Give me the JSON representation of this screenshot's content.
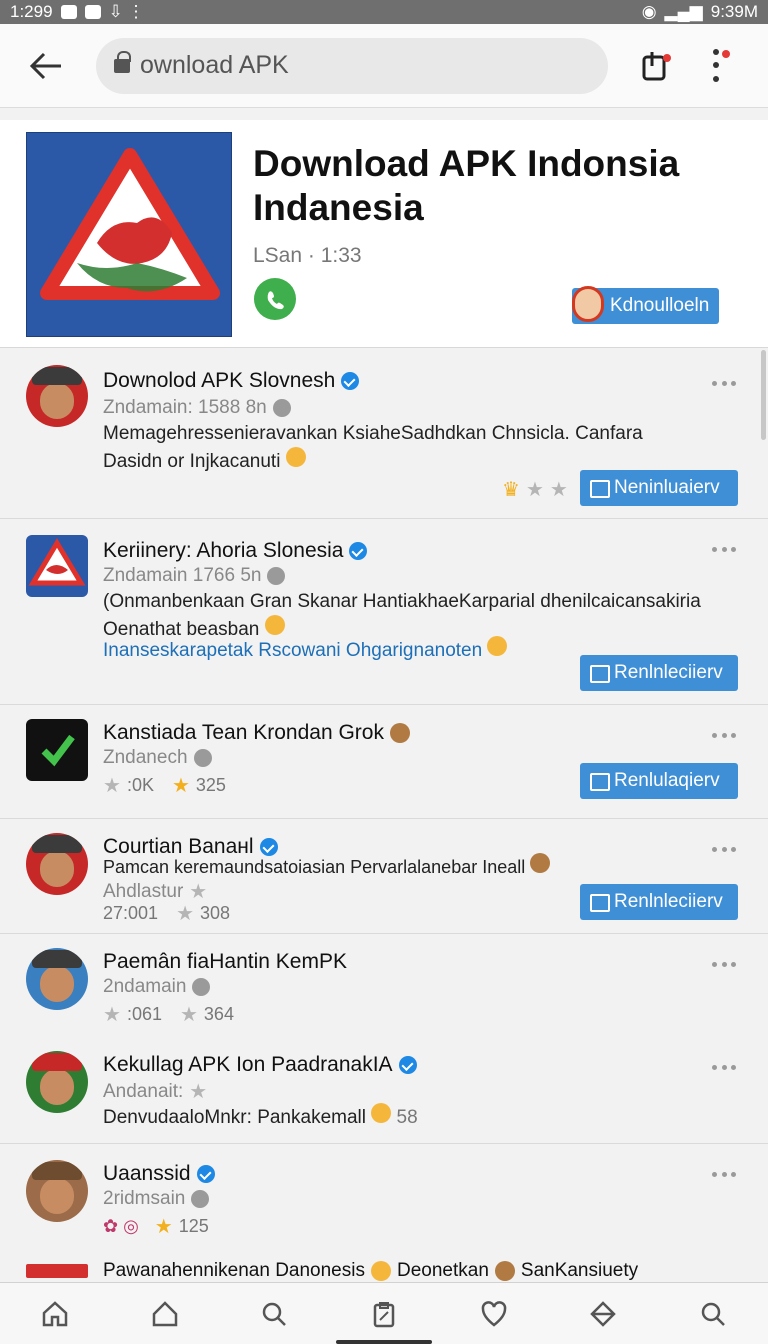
{
  "status_bar": {
    "time": "1:299",
    "clock_right": "9:39M"
  },
  "top_bar": {
    "url_text": "ownload APK"
  },
  "app_header": {
    "title": "Download APK Indonsia Indanesia",
    "meta": "LSan · 1:33",
    "download_label": "Kdnoulloeln"
  },
  "items": [
    {
      "name": "Downolod APK Slovnesh",
      "sub": "Zndamain: 1588 8n",
      "desc": "Memagehressenieravankan KsiaheSadhdkan Chnsicla. Canfara Dasidn or Injkacanuti",
      "action": "Neninluaierv"
    },
    {
      "name": "Keriinery: Ahoria Slonesia",
      "sub": "Zndamain 1766 5n",
      "desc": "(Onmanbenkaan Gran Skanar HantiakhaeKarparial dhenilcaicansakiria Oenathat beasban",
      "link": "Inanseskarapetak  Rscowani Ohgarignanoten",
      "action": "Renlnleciierv"
    },
    {
      "name": "Kanstiada Tean Krondan Grok",
      "sub": "Zndanech",
      "stat_a": ":0K",
      "stat_b": "325",
      "action": "Renlulaqierv"
    },
    {
      "name": "Courtian Banaнl",
      "desc": "Pamcan keremaundsatoiasian Pervarlalanebar Ineall",
      "sub": "Ahdlastur",
      "stat_a": "27:001",
      "stat_b": "308",
      "action": "Renlnleciierv"
    },
    {
      "name": "Paemân fiaHantin KemPK",
      "sub": "2ndamain",
      "stat_a": ":061",
      "stat_b": "364"
    },
    {
      "name": "Kekullag APK Ion PaadranakIA",
      "sub": "Andanait:",
      "desc": "DenvudaaloMnkr: Pankakemall",
      "stat_b": "58"
    },
    {
      "name": "Uaanssid",
      "sub": "2ridmsain",
      "stat_b": "125"
    },
    {
      "name": "Pawanahennikenan Danonesis",
      "tail_a": "Deonetkan",
      "tail_b": "SanKansiuety"
    }
  ]
}
